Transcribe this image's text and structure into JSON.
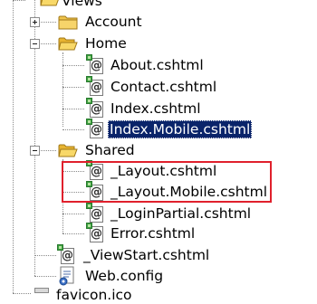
{
  "tree": {
    "root": {
      "label": "Views"
    },
    "folders": {
      "account": {
        "label": "Account"
      },
      "home": {
        "label": "Home"
      },
      "shared": {
        "label": "Shared"
      }
    },
    "home_files": [
      {
        "label": "About.cshtml"
      },
      {
        "label": "Contact.cshtml"
      },
      {
        "label": "Index.cshtml"
      },
      {
        "label": "Index.Mobile.cshtml"
      }
    ],
    "shared_files": [
      {
        "label": "_Layout.cshtml"
      },
      {
        "label": "_Layout.Mobile.cshtml"
      },
      {
        "label": "_LoginPartial.cshtml"
      },
      {
        "label": "Error.cshtml"
      }
    ],
    "root_files": [
      {
        "label": "_ViewStart.cshtml"
      },
      {
        "label": "Web.config"
      },
      {
        "label": "favicon.ico"
      }
    ],
    "selected": "Index.Mobile.cshtml"
  },
  "colors": {
    "selection": "#0a246a",
    "annotation": "#e0202c",
    "folder": "#f0c44a"
  }
}
